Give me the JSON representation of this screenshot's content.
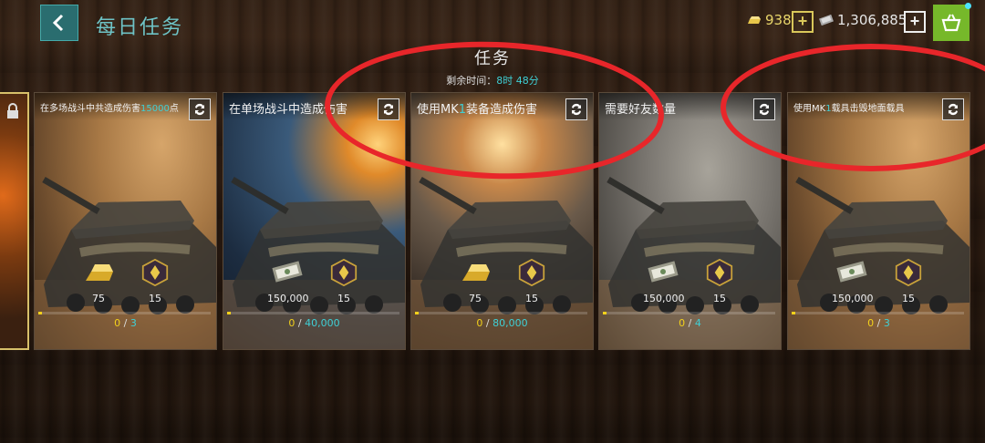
{
  "header": {
    "title": "每日任务",
    "gold": "938",
    "cash": "1,306,885"
  },
  "section": {
    "title": "任务",
    "timer_label": "剩余时间：",
    "timer_value": "8时 48分"
  },
  "cards": [
    {
      "title_pre": "在多场战斗中共造成伤害",
      "title_hl": "15000",
      "title_post": "点",
      "reward1_type": "gold",
      "reward1": "75",
      "reward2": "15",
      "progress_current": "0",
      "progress_total": "3",
      "scene": "desert"
    },
    {
      "title_pre": "在单场战斗中造成伤害",
      "title_hl": "",
      "title_post": "",
      "reward1_type": "cash",
      "reward1": "150,000",
      "reward2": "15",
      "progress_current": "0",
      "progress_total": "40,000",
      "scene": "night"
    },
    {
      "title_pre": "使用MK",
      "title_hl": "1",
      "title_post": "装备造成伤害",
      "reward1_type": "gold",
      "reward1": "75",
      "reward2": "15",
      "progress_current": "0",
      "progress_total": "80,000",
      "scene": "dusk"
    },
    {
      "title_pre": "需要好友数量",
      "title_hl": "",
      "title_post": "",
      "reward1_type": "cash",
      "reward1": "150,000",
      "reward2": "15",
      "progress_current": "0",
      "progress_total": "4",
      "scene": "grey"
    },
    {
      "title_pre": "使用MK",
      "title_hl": "1",
      "title_post": "载具击毁地面载具",
      "reward1_type": "cash",
      "reward1": "150,000",
      "reward2": "15",
      "progress_current": "0",
      "progress_total": "3",
      "scene": "desert"
    }
  ],
  "colors": {
    "accent_teal": "#3fd0d6",
    "progress_yellow": "#f3d11b",
    "shop_green": "#76b82a",
    "annotation_red": "#e8262a"
  },
  "icons": [
    "back-arrow-icon",
    "gold-bar-icon",
    "cash-icon",
    "plus-icon",
    "shop-basket-icon",
    "refresh-icon",
    "lock-icon",
    "rank-medal-icon"
  ]
}
